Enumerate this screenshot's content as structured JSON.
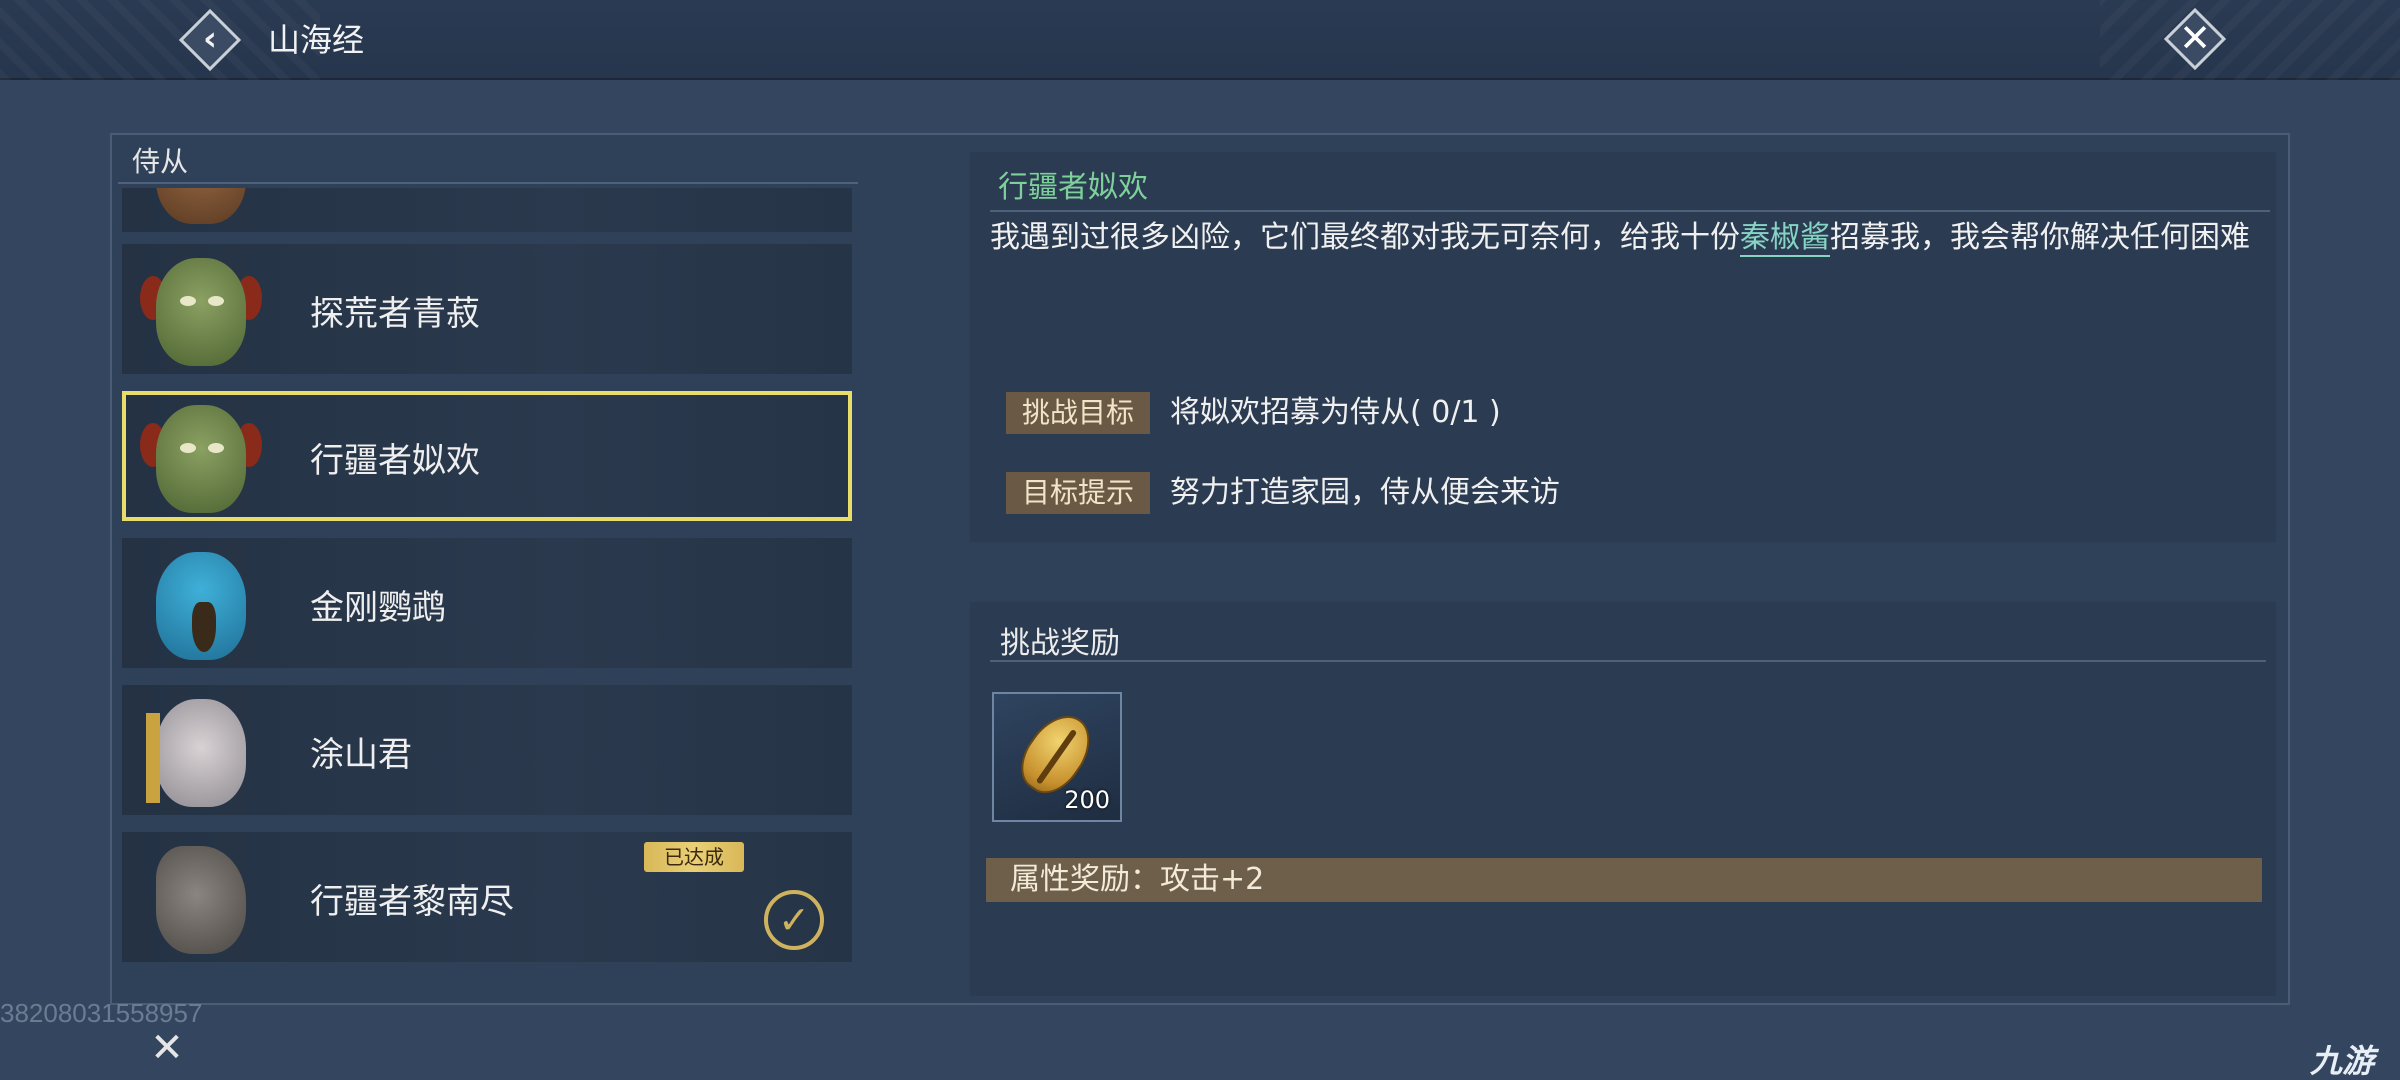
{
  "header": {
    "title": "山海经"
  },
  "left": {
    "section_title": "侍从",
    "items": [
      {
        "name": "",
        "state": "partial"
      },
      {
        "name": "探荒者青菽",
        "state": "normal"
      },
      {
        "name": "行疆者姒欢",
        "state": "selected"
      },
      {
        "name": "金刚鹦鹉",
        "state": "normal"
      },
      {
        "name": "涂山君",
        "state": "normal"
      },
      {
        "name": "行疆者黎南尽",
        "state": "done",
        "done_label": "已达成"
      }
    ]
  },
  "detail": {
    "title": "行疆者姒欢",
    "desc_pre": "我遇到过很多凶险，它们最终都对我无可奈何，给我十份",
    "desc_highlight": "秦椒酱",
    "desc_post": "招募我，我会帮你解决任何困难",
    "goal_label": "挑战目标",
    "goal_text": "将姒欢招募为侍从( 0/1 )",
    "hint_label": "目标提示",
    "hint_text": "努力打造家园，侍从便会来访"
  },
  "reward": {
    "title": "挑战奖励",
    "item_count": "200",
    "item_icon": "shell-coin-icon",
    "attr_text": "属性奖励：攻击+2"
  },
  "footer": {
    "uid": "38208031558957",
    "watermark": "九游"
  },
  "colors": {
    "accent_green": "#7ed09a",
    "highlight_cyan": "#86d4c4",
    "selected_outline": "#e8dc6a",
    "tag_brown": "#6a5a45"
  }
}
